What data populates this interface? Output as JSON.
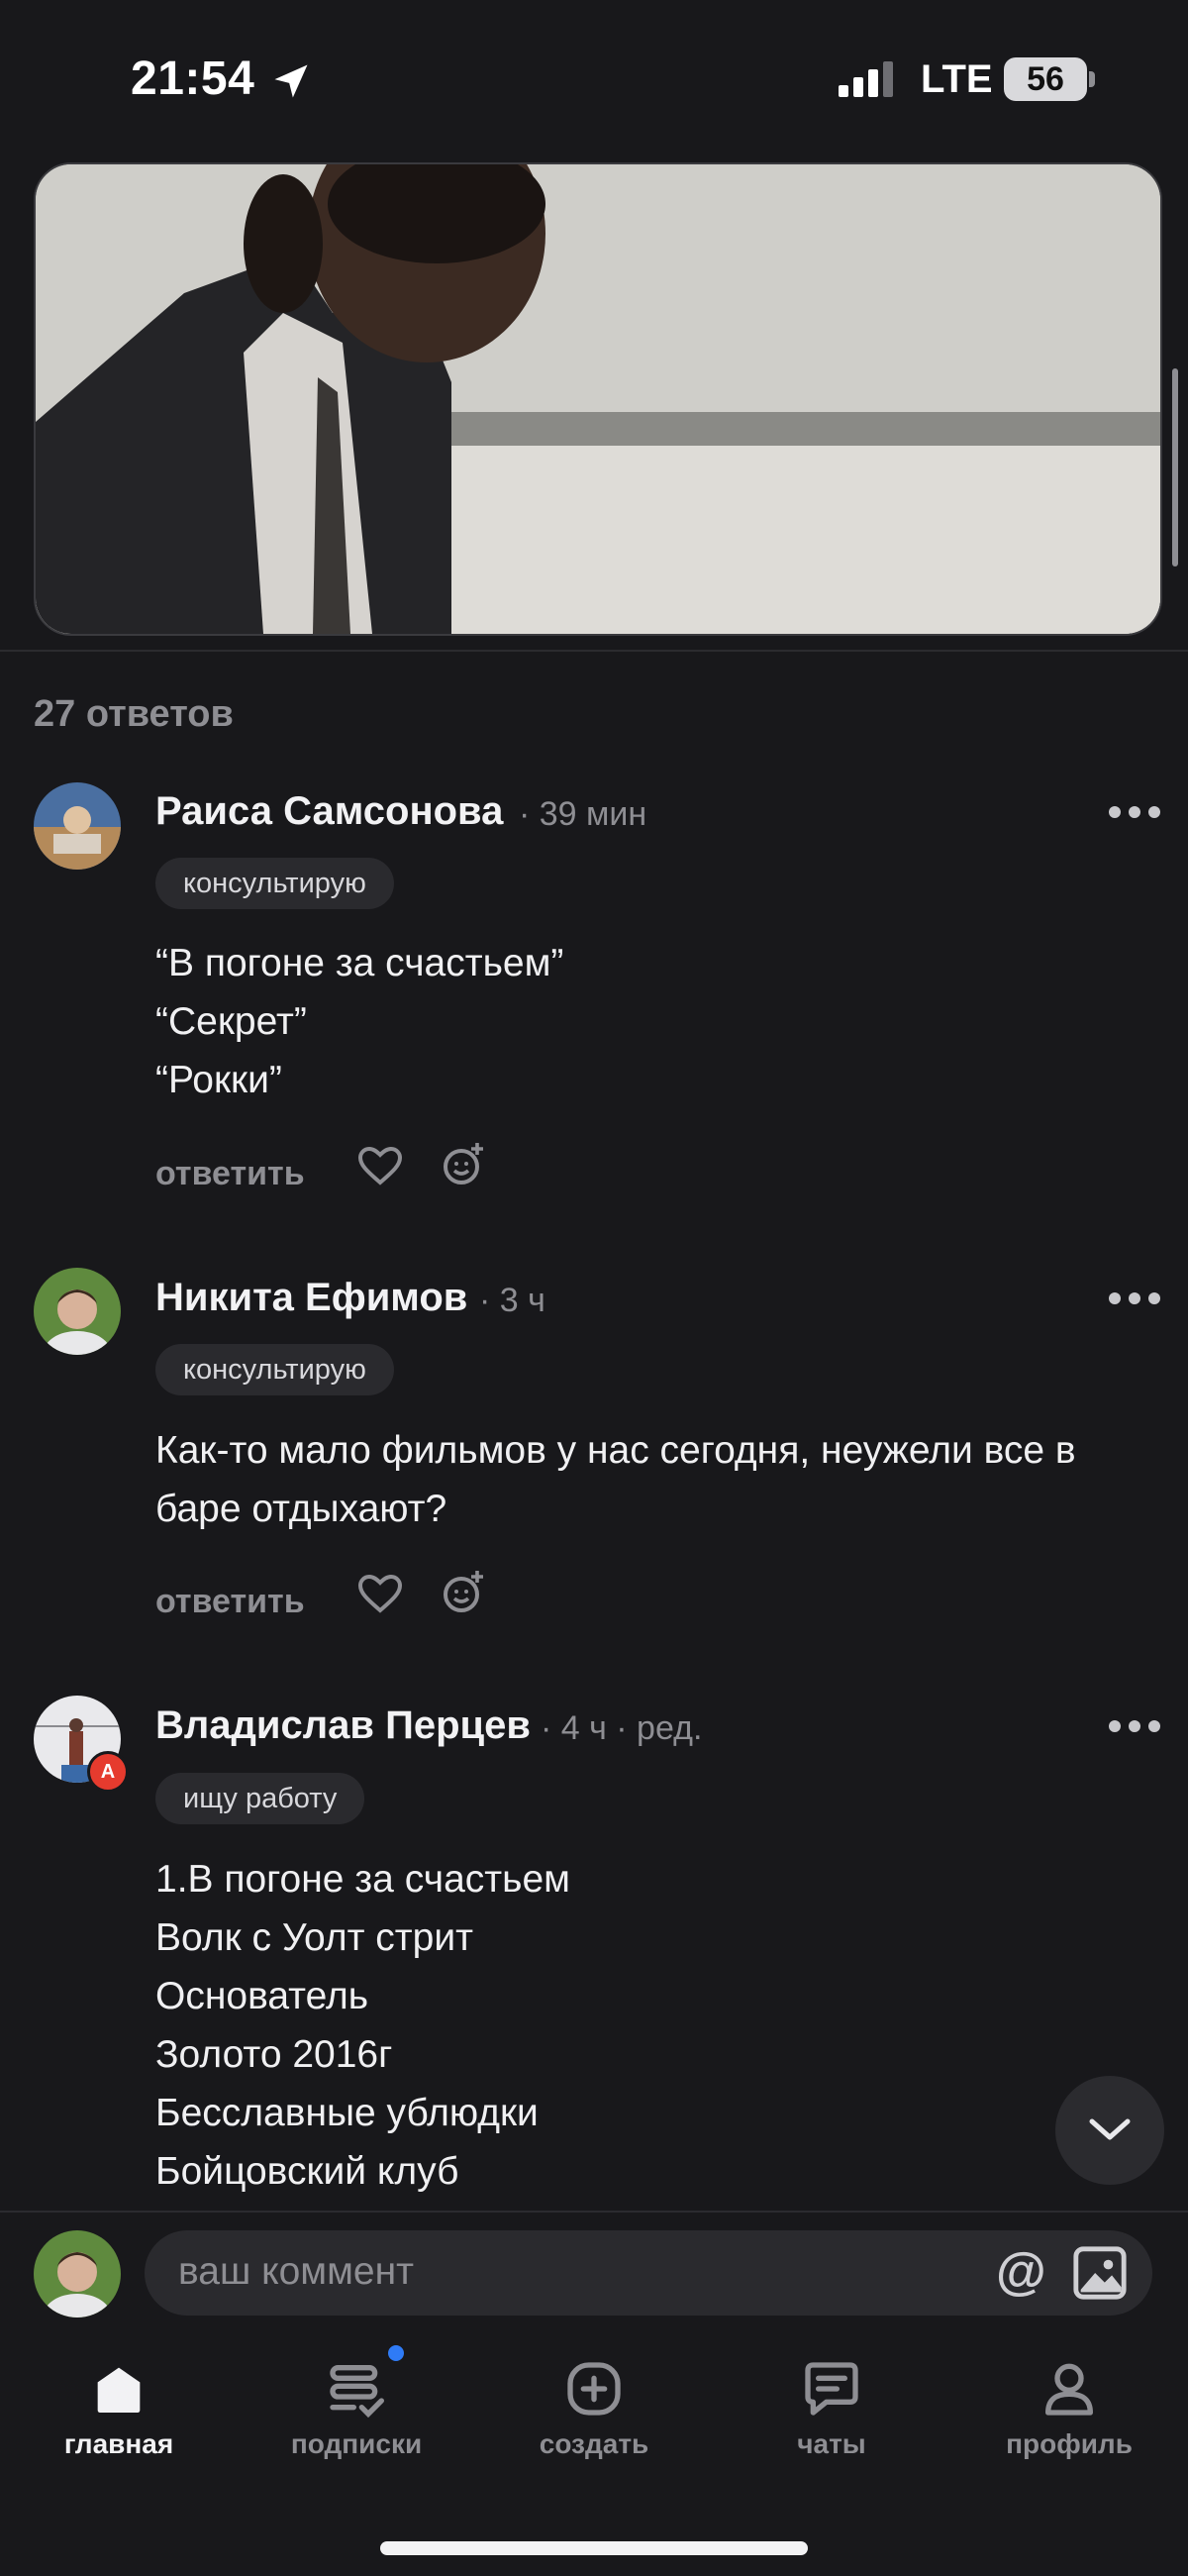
{
  "status_bar": {
    "time": "21:54",
    "network": "LTE",
    "battery": "56"
  },
  "thread": {
    "answers_count": "27 ответов"
  },
  "comments": [
    {
      "author": "Раиса Самсонова",
      "meta": "· 39 мин",
      "tag": "консультирую",
      "text": "“В погоне за счастьем”\n“Секрет”\n“Рокки”",
      "reply_label": "ответить"
    },
    {
      "author": "Никита Ефимов",
      "meta": "· 3 ч",
      "tag": "консультирую",
      "text": "Как-то мало фильмов у нас сегодня, неужели все в\nбаре отдыхают?",
      "reply_label": "ответить"
    },
    {
      "author": "Владислав Перцев",
      "meta": "· 4 ч · ред.",
      "tag": "ищу работу",
      "badge": "A",
      "text": "1.В погоне за счастьем\nВолк с Уолт стрит\nОснователь\nЗолото 2016г\nБесславные ублюдки\nБойцовский клуб",
      "reply_label": ""
    }
  ],
  "comment_input": {
    "placeholder": "ваш коммент",
    "at_symbol": "@"
  },
  "nav": {
    "items": [
      {
        "label": "главная",
        "icon": "home-icon",
        "active": true
      },
      {
        "label": "подписки",
        "icon": "subscriptions-icon",
        "has_dot": true
      },
      {
        "label": "создать",
        "icon": "plus-square-icon"
      },
      {
        "label": "чаты",
        "icon": "chat-icon"
      },
      {
        "label": "профиль",
        "icon": "person-icon"
      }
    ]
  },
  "colors": {
    "background": "#18181b",
    "accent_dot": "#2f7bf6",
    "badge_red": "#e63b2e"
  }
}
